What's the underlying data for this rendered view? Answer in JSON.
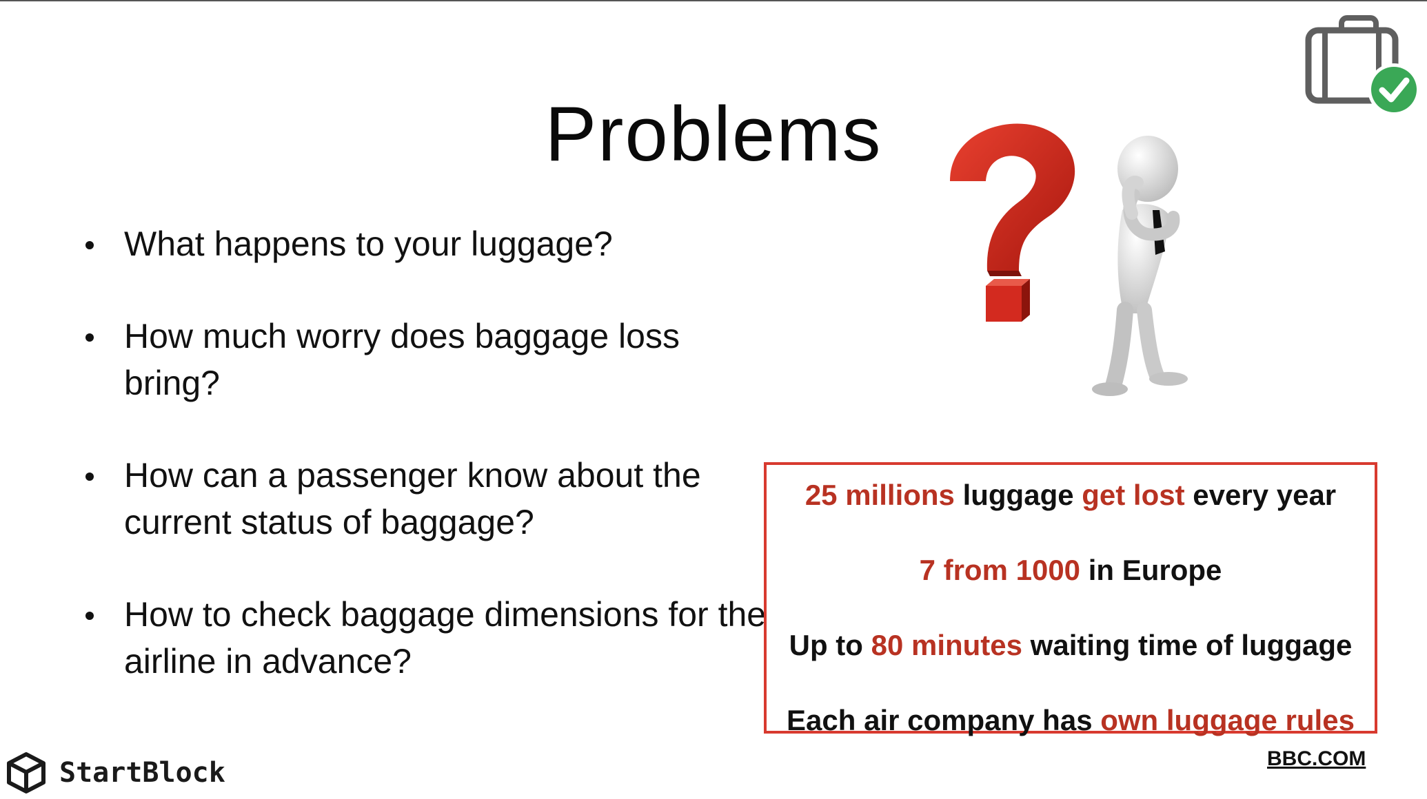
{
  "slide": {
    "title": "Problems"
  },
  "bullets": [
    "What happens to your luggage?",
    "How much worry does baggage loss bring?",
    "How can a passenger know about the current status of baggage?",
    "How to check baggage dimensions for the airline in advance?"
  ],
  "stats": {
    "line1": {
      "a": "25 millions",
      "b": " luggage ",
      "c": "get lost",
      "d": " every year"
    },
    "line2": {
      "a": "7 from 1000",
      "b": " in Europe"
    },
    "line3": {
      "a": "Up to ",
      "b": "80 minutes",
      "c": " waiting time of luggage"
    },
    "line4": {
      "a": "Each air company has ",
      "b": "own luggage rules"
    }
  },
  "source": "BBC.COM",
  "brand": {
    "name": "StartBlock",
    "logo_icon": "cube-icon"
  },
  "images": {
    "illustration": "question-mark-figure-icon",
    "top_right": "luggage-check-icon"
  },
  "colors": {
    "highlight": "#b83222",
    "box_border": "#d83a2f",
    "check_green": "#3aa856",
    "question_red": "#d32a1f"
  }
}
